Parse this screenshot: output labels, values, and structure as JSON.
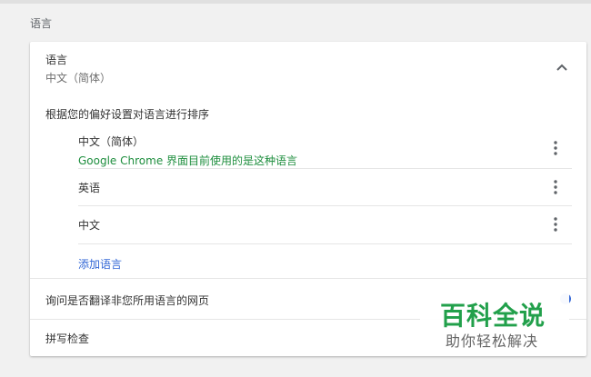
{
  "section": {
    "heading": "语言"
  },
  "language_panel": {
    "title": "语言",
    "current_language": "中文（简体）",
    "collapse_icon": "chevron-up-icon",
    "order_label": "根据您的偏好设置对语言进行排序",
    "languages": [
      {
        "name": "中文（简体）",
        "note": "Google Chrome 界面目前使用的是这种语言"
      },
      {
        "name": "英语"
      },
      {
        "name": "中文"
      }
    ],
    "more_icon": "more-vert-icon",
    "add_language": "添加语言"
  },
  "translate": {
    "label": "询问是否翻译非您所用语言的网页"
  },
  "spellcheck": {
    "label": "拼写检查"
  },
  "watermark": {
    "title": "百科全说",
    "subtitle": "助你轻松解决"
  },
  "colors": {
    "accent": "#3367d6",
    "note_green": "#1e8e3e",
    "watermark_green": "#22a04b"
  }
}
